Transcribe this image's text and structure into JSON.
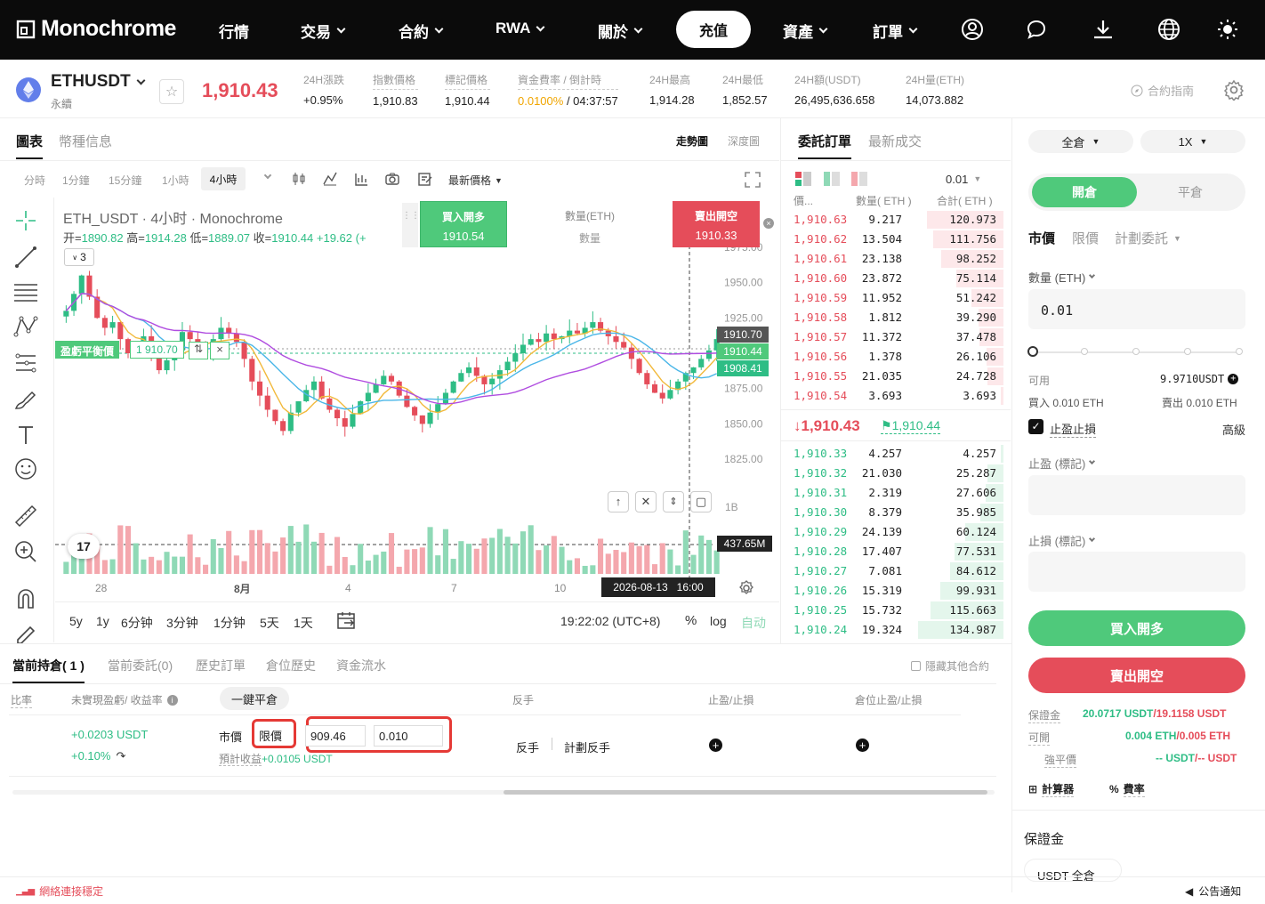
{
  "nav": {
    "logo": "Monochrome",
    "items": [
      {
        "label": "行情",
        "dropdown": false
      },
      {
        "label": "交易",
        "dropdown": true
      },
      {
        "label": "合約",
        "dropdown": true
      },
      {
        "label": "RWA",
        "dropdown": true
      },
      {
        "label": "關於",
        "dropdown": true
      }
    ],
    "topup": "充值",
    "items2": [
      {
        "label": "資產",
        "dropdown": true
      },
      {
        "label": "訂單",
        "dropdown": true
      }
    ],
    "icons": [
      "user-icon",
      "chat-icon",
      "download-icon",
      "globe-icon",
      "theme-sun-icon"
    ]
  },
  "ticker": {
    "symbol": "ETHUSDT",
    "type": "永續",
    "last_price": "1,910.43",
    "stats": [
      {
        "label": "24H漲跌",
        "value": "+0.95%",
        "color": "green"
      },
      {
        "label": "指數價格",
        "value": "1,910.83"
      },
      {
        "label": "標記價格",
        "value": "1,910.44"
      },
      {
        "label": "資金費率 / 倒計時",
        "value_a": "0.0100%",
        "value_b": " / 04:37:57"
      },
      {
        "label": "24H最高",
        "value": "1,914.28"
      },
      {
        "label": "24H最低",
        "value": "1,852.57"
      },
      {
        "label": "24H額(USDT)",
        "value": "26,495,636.658"
      },
      {
        "label": "24H量(ETH)",
        "value": "14,073.882"
      }
    ],
    "guide": "合約指南"
  },
  "chart_panel": {
    "tabs": [
      "圖表",
      "幣種信息"
    ],
    "views": [
      "走勢圖",
      "深度圖"
    ],
    "intervals": [
      "分時",
      "1分鐘",
      "15分鐘",
      "1小時",
      "4小時"
    ],
    "price_type": "最新價格",
    "title": "ETH_USDT · 4小时 · Monochrome",
    "ohlc": {
      "o_label": "开=",
      "o": "1890.82",
      "h_label": "高=",
      "h": "1914.28",
      "l_label": "低=",
      "l": "1889.07",
      "c_label": "收=",
      "c": "1910.44",
      "chg": "+19.62 (+"
    },
    "indicator_count": "3",
    "buy_btn": {
      "label": "買入開多",
      "price": "1910.54"
    },
    "qty_label": "數量(ETH)",
    "qty_placeholder": "數量",
    "sell_btn": {
      "label": "賣出開空",
      "price": "1910.33"
    },
    "breakeven": {
      "label": "盈虧平衡價",
      "value": "1 910.70"
    },
    "price_tags": {
      "top": "1910.70",
      "mid": "1910.44",
      "bot": "1908.41",
      "vol": "437.65M"
    },
    "vol_axis": "1B",
    "x_labels": [
      "28",
      "8月",
      "4",
      "7",
      "10"
    ],
    "crosshair_time": "2026-08-13   16:00",
    "ranges": [
      "5y",
      "1y",
      "6分钟",
      "3分钟",
      "1分钟",
      "5天",
      "1天"
    ],
    "clock": "19:22:02 (UTC+8)",
    "pct": "%",
    "log": "log",
    "auto": "自动"
  },
  "chart_data": {
    "type": "candlestick",
    "y_ticks": [
      "1975.00",
      "1950.00",
      "1925.00",
      "1900.00",
      "1875.00",
      "1850.00",
      "1825.00"
    ],
    "ylim": [
      1815,
      1985
    ],
    "close_series": [
      1930,
      1942,
      1955,
      1940,
      1925,
      1918,
      1922,
      1910,
      1900,
      1905,
      1912,
      1898,
      1888,
      1895,
      1902,
      1915,
      1910,
      1905,
      1900,
      1910,
      1918,
      1914,
      1908,
      1896,
      1880,
      1870,
      1860,
      1852,
      1845,
      1858,
      1866,
      1874,
      1880,
      1868,
      1860,
      1854,
      1848,
      1857,
      1866,
      1872,
      1878,
      1884,
      1880,
      1870,
      1862,
      1856,
      1850,
      1858,
      1864,
      1872,
      1880,
      1886,
      1890,
      1884,
      1878,
      1882,
      1888,
      1894,
      1900,
      1906,
      1910,
      1908,
      1914,
      1910,
      1912,
      1916,
      1914,
      1918,
      1922,
      1916,
      1912,
      1908,
      1904,
      1896,
      1886,
      1878,
      1872,
      1868,
      1874,
      1880,
      1886,
      1890,
      1896,
      1902,
      1910
    ]
  },
  "orderbook": {
    "tabs": [
      "委託訂單",
      "最新成交"
    ],
    "precision": "0.01",
    "headers": [
      "價...",
      "數量( ETH )",
      "合計( ETH )"
    ],
    "asks": [
      [
        "1,910.63",
        "9.217",
        "120.973"
      ],
      [
        "1,910.62",
        "13.504",
        "111.756"
      ],
      [
        "1,910.61",
        "23.138",
        "98.252"
      ],
      [
        "1,910.60",
        "23.872",
        "75.114"
      ],
      [
        "1,910.59",
        "11.952",
        "51.242"
      ],
      [
        "1,910.58",
        "1.812",
        "39.290"
      ],
      [
        "1,910.57",
        "11.372",
        "37.478"
      ],
      [
        "1,910.56",
        "1.378",
        "26.106"
      ],
      [
        "1,910.55",
        "21.035",
        "24.728"
      ],
      [
        "1,910.54",
        "3.693",
        "3.693"
      ]
    ],
    "last_price": "1,910.43",
    "mark_price": "1,910.44",
    "bids": [
      [
        "1,910.33",
        "4.257",
        "4.257"
      ],
      [
        "1,910.32",
        "21.030",
        "25.287"
      ],
      [
        "1,910.31",
        "2.319",
        "27.606"
      ],
      [
        "1,910.30",
        "8.379",
        "35.985"
      ],
      [
        "1,910.29",
        "24.139",
        "60.124"
      ],
      [
        "1,910.28",
        "17.407",
        "77.531"
      ],
      [
        "1,910.27",
        "7.081",
        "84.612"
      ],
      [
        "1,910.26",
        "15.319",
        "99.931"
      ],
      [
        "1,910.25",
        "15.732",
        "115.663"
      ],
      [
        "1,910.24",
        "19.324",
        "134.987"
      ]
    ]
  },
  "trade": {
    "margin_mode": "全倉",
    "leverage": "1X",
    "open": "開倉",
    "close": "平倉",
    "order_types": [
      "市價",
      "限價",
      "計劃委託"
    ],
    "qty_label": "數量 (ETH)",
    "qty_value": "0.01",
    "avail_label": "可用",
    "avail_value": "9.9710USDT",
    "buy_qty": "買入 0.010 ETH",
    "sell_qty": "賣出 0.010 ETH",
    "tpsl": "止盈止損",
    "advanced": "高級",
    "tp_label": "止盈 (標記)",
    "sl_label": "止損 (標記)",
    "buy_long": "買入開多",
    "sell_short": "賣出開空",
    "margin_label": "保證金",
    "margin_value_a": "20.0717 USDT",
    "margin_value_b": "/19.1158 USDT",
    "open_label": "可開",
    "open_value_a": "0.004 ETH",
    "open_value_b": "/0.005 ETH",
    "liq_label": "強平價",
    "liq_value_a": "-- USDT",
    "liq_value_b": "/-- USDT",
    "calc": "計算器",
    "fee": "費率",
    "section": "保證金",
    "margin_mode2": "USDT 全倉"
  },
  "positions": {
    "tabs": [
      "當前持倉( 1 )",
      "當前委託(0)",
      "歷史訂單",
      "倉位歷史",
      "資金流水"
    ],
    "hide_other": "隱藏其他合約",
    "col_ratio": "比率",
    "col_pnl": "未實現盈虧/ 收益率",
    "close_all": "一鍵平倉",
    "col_reverse": "反手",
    "col_tpsl": "止盈/止損",
    "col_pos_tpsl": "倉位止盈/止損",
    "pnl": "+0.0203 USDT",
    "roe": "+0.10%",
    "market": "市價",
    "limit": "限價",
    "limit_price": "909.46",
    "limit_qty": "0.010",
    "est_label": "預計收益",
    "est_value": "+0.0105 USDT",
    "reverse": "反手",
    "plan_reverse": "計劃反手"
  },
  "footer": {
    "status": "網絡連接穩定",
    "notice": "公告通知"
  },
  "colors": {
    "green": "#2ebd85",
    "red": "#e54d5a",
    "highlight": "#e53935"
  }
}
